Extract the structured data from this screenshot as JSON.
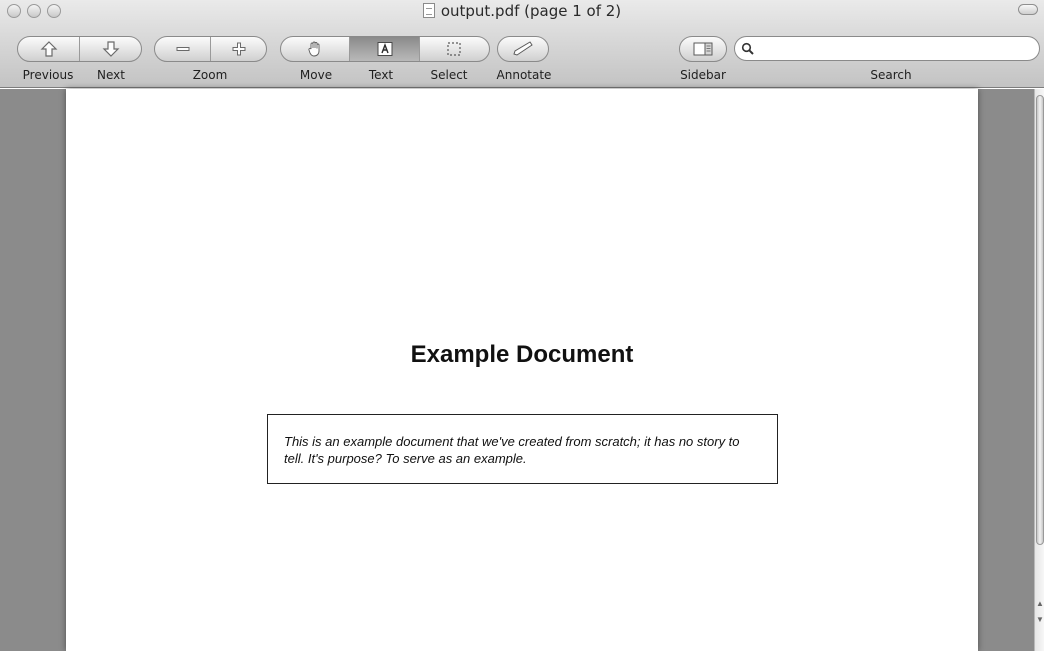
{
  "window": {
    "title": "output.pdf (page 1 of 2)"
  },
  "toolbar": {
    "previous_label": "Previous",
    "next_label": "Next",
    "zoom_label": "Zoom",
    "move_label": "Move",
    "text_label": "Text",
    "select_label": "Select",
    "annotate_label": "Annotate",
    "sidebar_label": "Sidebar",
    "search_label": "Search",
    "active_tool": "Text",
    "search_value": ""
  },
  "document": {
    "title": "Example Document",
    "abstract": "This is an example document that we've created from scratch; it has no story to tell. It's purpose? To serve as an example."
  },
  "icons": {
    "previous": "up-arrow-icon",
    "next": "down-arrow-icon",
    "zoom_out": "minus-icon",
    "zoom_in": "plus-icon",
    "move": "hand-icon",
    "text": "text-cursor-icon",
    "select": "marquee-icon",
    "annotate": "pencil-icon",
    "sidebar": "sidebar-icon",
    "search": "magnifier-icon"
  }
}
